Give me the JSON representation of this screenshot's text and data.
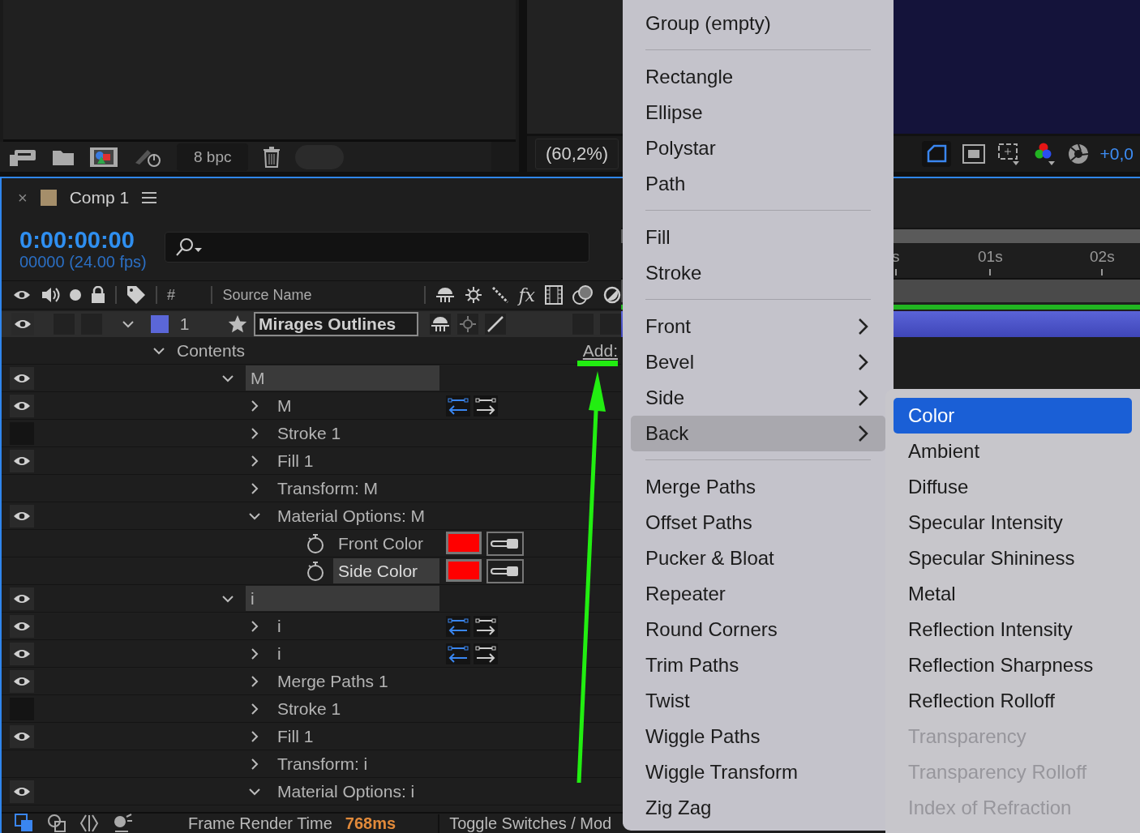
{
  "project_panel": {
    "bit_depth": "8 bpc"
  },
  "viewer": {
    "zoom": "(60,2%)",
    "exposure": "+0,0"
  },
  "comp_tab": {
    "close": "×",
    "title": "Comp 1"
  },
  "time": {
    "timecode": "0:00:00:00",
    "frame_info": "00000 (24.00 fps)"
  },
  "columns": {
    "number": "#",
    "source_name": "Source Name",
    "effects": "fx"
  },
  "layer": {
    "number": "1",
    "name": "Mirages Outlines",
    "expanded": true
  },
  "contents": {
    "label": "Contents",
    "add_label": "Add:",
    "expanded": true,
    "children": [
      {
        "kind": "group",
        "label": "M",
        "visible": true,
        "expanded": true,
        "selected": false,
        "children": [
          {
            "kind": "path",
            "label": "M",
            "visible": true,
            "expanded": false,
            "selected": false
          },
          {
            "kind": "property_group",
            "label": "Stroke 1",
            "visible": false,
            "expanded": false,
            "selected": false
          },
          {
            "kind": "property_group",
            "label": "Fill 1",
            "visible": true,
            "expanded": false,
            "selected": false
          },
          {
            "kind": "property_group",
            "label": "Transform: M",
            "expanded": false,
            "selected": false
          },
          {
            "kind": "property_group",
            "label": "Material Options: M",
            "visible": true,
            "expanded": true,
            "selected": false,
            "children": [
              {
                "kind": "color",
                "label": "Front Color",
                "color": "#ff0000",
                "selected": false
              },
              {
                "kind": "color",
                "label": "Side Color",
                "color": "#ff0000",
                "selected": true
              }
            ]
          }
        ]
      },
      {
        "kind": "group",
        "label": "i",
        "visible": true,
        "expanded": true,
        "selected": false,
        "children": [
          {
            "kind": "path",
            "label": "i",
            "visible": true,
            "expanded": false,
            "selected": false
          },
          {
            "kind": "path",
            "label": "i",
            "visible": true,
            "expanded": false,
            "selected": false
          },
          {
            "kind": "property_group",
            "label": "Merge Paths 1",
            "visible": true,
            "expanded": false,
            "selected": false
          },
          {
            "kind": "property_group",
            "label": "Stroke 1",
            "visible": false,
            "expanded": false,
            "selected": false
          },
          {
            "kind": "property_group",
            "label": "Fill 1",
            "visible": true,
            "expanded": false,
            "selected": false
          },
          {
            "kind": "property_group",
            "label": "Transform: i",
            "expanded": false,
            "selected": false
          },
          {
            "kind": "property_group",
            "label": "Material Options: i",
            "visible": true,
            "expanded": true,
            "selected": false
          }
        ]
      }
    ]
  },
  "ruler": {
    "ticks": [
      "s",
      "01s",
      "02s"
    ]
  },
  "status_bar": {
    "label": "Frame Render Time",
    "value": "768ms",
    "toggle": "Toggle Switches / Mod"
  },
  "menu": {
    "items": [
      {
        "kind": "item",
        "label": "Group (empty)",
        "has_submenu": false,
        "selected": false
      },
      {
        "kind": "separator"
      },
      {
        "kind": "item",
        "label": "Rectangle",
        "has_submenu": false,
        "selected": false
      },
      {
        "kind": "item",
        "label": "Ellipse",
        "has_submenu": false,
        "selected": false
      },
      {
        "kind": "item",
        "label": "Polystar",
        "has_submenu": false,
        "selected": false
      },
      {
        "kind": "item",
        "label": "Path",
        "has_submenu": false,
        "selected": false
      },
      {
        "kind": "separator"
      },
      {
        "kind": "item",
        "label": "Fill",
        "has_submenu": false,
        "selected": false
      },
      {
        "kind": "item",
        "label": "Stroke",
        "has_submenu": false,
        "selected": false
      },
      {
        "kind": "separator"
      },
      {
        "kind": "item",
        "label": "Front",
        "has_submenu": true,
        "selected": false
      },
      {
        "kind": "item",
        "label": "Bevel",
        "has_submenu": true,
        "selected": false
      },
      {
        "kind": "item",
        "label": "Side",
        "has_submenu": true,
        "selected": false
      },
      {
        "kind": "item",
        "label": "Back",
        "has_submenu": true,
        "selected": true
      },
      {
        "kind": "separator"
      },
      {
        "kind": "item",
        "label": "Merge Paths",
        "has_submenu": false,
        "selected": false
      },
      {
        "kind": "item",
        "label": "Offset Paths",
        "has_submenu": false,
        "selected": false
      },
      {
        "kind": "item",
        "label": "Pucker & Bloat",
        "has_submenu": false,
        "selected": false
      },
      {
        "kind": "item",
        "label": "Repeater",
        "has_submenu": false,
        "selected": false
      },
      {
        "kind": "item",
        "label": "Round Corners",
        "has_submenu": false,
        "selected": false
      },
      {
        "kind": "item",
        "label": "Trim Paths",
        "has_submenu": false,
        "selected": false
      },
      {
        "kind": "item",
        "label": "Twist",
        "has_submenu": false,
        "selected": false
      },
      {
        "kind": "item",
        "label": "Wiggle Paths",
        "has_submenu": false,
        "selected": false
      },
      {
        "kind": "item",
        "label": "Wiggle Transform",
        "has_submenu": false,
        "selected": false
      },
      {
        "kind": "item",
        "label": "Zig Zag",
        "has_submenu": false,
        "selected": false
      }
    ]
  },
  "submenu": {
    "items": [
      {
        "label": "Color",
        "selected": true,
        "disabled": false
      },
      {
        "label": "Ambient",
        "selected": false,
        "disabled": false
      },
      {
        "label": "Diffuse",
        "selected": false,
        "disabled": false
      },
      {
        "label": "Specular Intensity",
        "selected": false,
        "disabled": false
      },
      {
        "label": "Specular Shininess",
        "selected": false,
        "disabled": false
      },
      {
        "label": "Metal",
        "selected": false,
        "disabled": false
      },
      {
        "label": "Reflection Intensity",
        "selected": false,
        "disabled": false
      },
      {
        "label": "Reflection Sharpness",
        "selected": false,
        "disabled": false
      },
      {
        "label": "Reflection Rolloff",
        "selected": false,
        "disabled": false
      },
      {
        "label": "Transparency",
        "selected": false,
        "disabled": true
      },
      {
        "label": "Transparency Rolloff",
        "selected": false,
        "disabled": true
      },
      {
        "label": "Index of Refraction",
        "selected": false,
        "disabled": true
      }
    ]
  }
}
